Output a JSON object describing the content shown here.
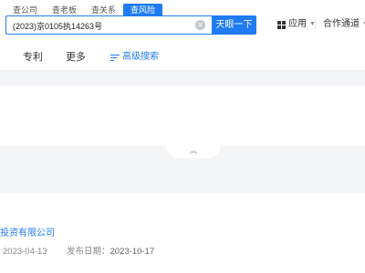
{
  "search_tabs": [
    "查公司",
    "查老板",
    "查关系",
    "查风险"
  ],
  "active_tab": "查风险",
  "search": {
    "value": "(2023)京0105执14263号",
    "button": "天眼一下"
  },
  "header_menu": {
    "apps": "应用",
    "cooperation": "合作通道"
  },
  "nav": {
    "items": [
      "专利",
      "更多"
    ],
    "advanced_search": "高级搜索"
  },
  "result": {
    "company_fragment": "投资有限公司",
    "date_partial": "2023-04-13",
    "publish_label": "发布日期：",
    "publish_date": "2023-10-17"
  },
  "colors": {
    "accent": "#1f7bf2",
    "background": "#f4f5f7"
  }
}
